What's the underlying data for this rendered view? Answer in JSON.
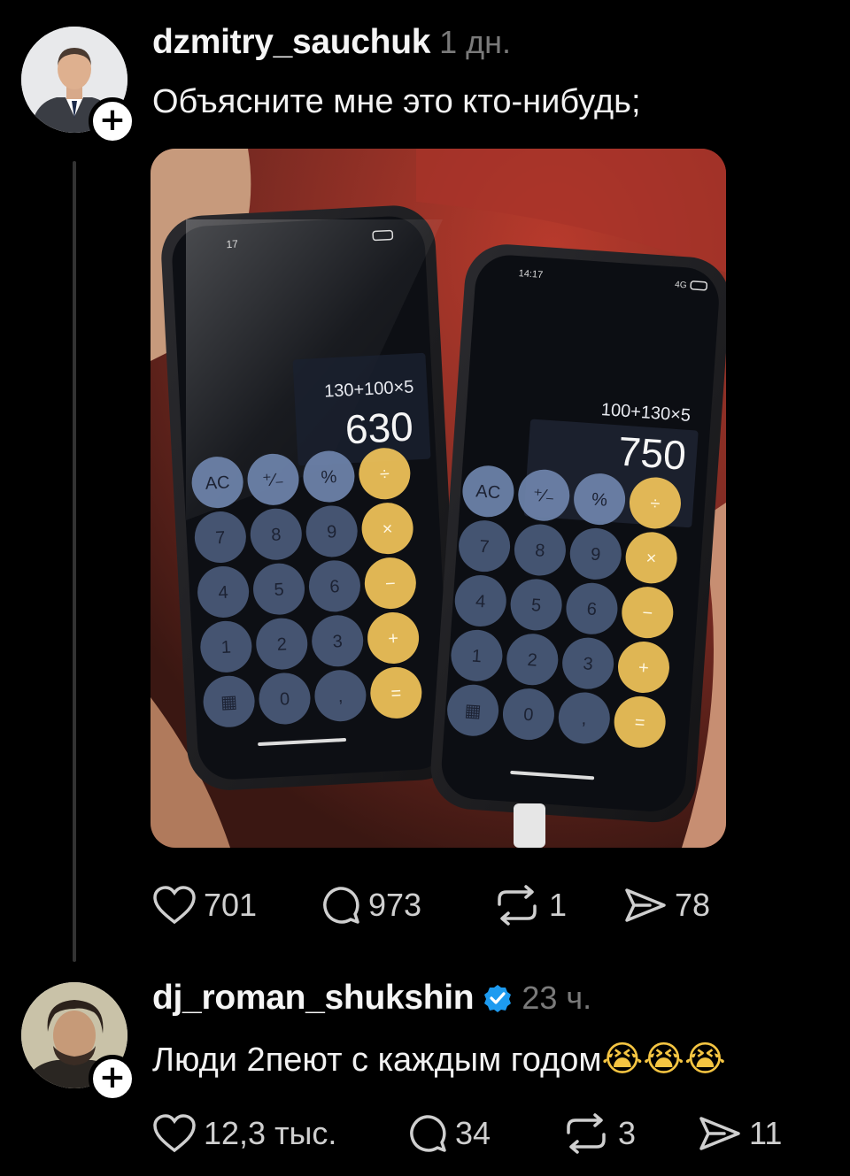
{
  "post": {
    "username": "dzmitry_sauchuk",
    "time": "1 дн.",
    "text": "Объясните мне это кто-нибудь;",
    "likes": "701",
    "comments": "973",
    "reposts": "1",
    "shares": "78",
    "image": {
      "left_phone": {
        "status_time": "17",
        "expression": "130+100×5",
        "result": "630",
        "keys": [
          "AC",
          "⁺∕₋",
          "%",
          "÷",
          "7",
          "8",
          "9",
          "×",
          "4",
          "5",
          "6",
          "−",
          "1",
          "2",
          "3",
          "+",
          "▦",
          "0",
          ",",
          "="
        ]
      },
      "right_phone": {
        "status_time": "14:17",
        "network": "4G",
        "expression": "100+130×5",
        "result": "750",
        "keys": [
          "AC",
          "⁺∕₋",
          "%",
          "÷",
          "7",
          "8",
          "9",
          "×",
          "4",
          "5",
          "6",
          "−",
          "1",
          "2",
          "3",
          "+",
          "▦",
          "0",
          ",",
          "="
        ]
      }
    }
  },
  "reply": {
    "username": "dj_roman_shukshin",
    "time": "23 ч.",
    "text": "Люди 2пеют с каждым годом",
    "emojis": "😭😭😭",
    "likes": "12,3 тыс.",
    "comments": "34",
    "reposts": "3",
    "shares": "11"
  },
  "colors": {
    "background": "#000000",
    "verified": "#1d9bf0",
    "calc_operator": "#f2c45a",
    "calc_digit": "#4a5a7a"
  }
}
